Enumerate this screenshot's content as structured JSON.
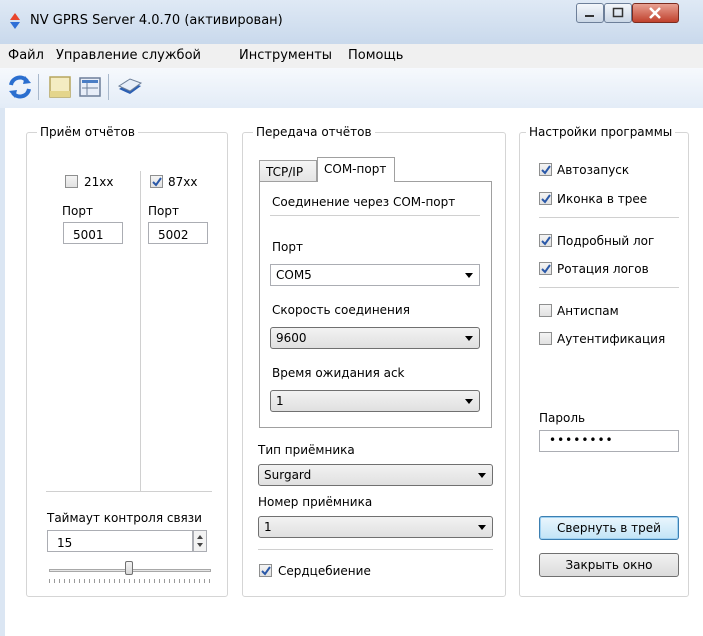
{
  "window": {
    "title": "NV GPRS Server 4.0.70  (активирован)"
  },
  "menu": [
    "Файл",
    "Управление службой",
    "Инструменты",
    "Помощь"
  ],
  "toolbar": {
    "icons": [
      "refresh-icon",
      "panel-icon",
      "grid-icon",
      "book-icon"
    ]
  },
  "reports_in": {
    "title": "Приём отчётов",
    "port_a": {
      "label": "21xx",
      "checked": false,
      "port_label": "Порт",
      "port_value": "5001"
    },
    "port_b": {
      "label": "87xx",
      "checked": true,
      "port_label": "Порт",
      "port_value": "5002"
    },
    "timeout_label": "Таймаут контроля связи",
    "timeout_value": "15"
  },
  "reports_out": {
    "title": "Передача отчётов",
    "tabs": [
      "TCP/IP",
      "COM-порт"
    ],
    "active_tab": 1,
    "com": {
      "heading": "Соединение через COM-порт",
      "port_label": "Порт",
      "port_value": "COM5",
      "speed_label": "Скорость соединения",
      "speed_value": "9600",
      "ack_label": "Время ожидания ack",
      "ack_value": "1"
    },
    "receiver_type_label": "Тип приёмника",
    "receiver_type_value": "Surgard",
    "receiver_number_label": "Номер приёмника",
    "receiver_number_value": "1",
    "heartbeat_label": "Сердцебиение",
    "heartbeat_checked": true
  },
  "settings": {
    "title": "Настройки программы",
    "autostart": {
      "label": "Автозапуск",
      "checked": true
    },
    "tray_icon": {
      "label": "Иконка в трее",
      "checked": true
    },
    "verbose_log": {
      "label": "Подробный лог",
      "checked": true
    },
    "log_rotation": {
      "label": "Ротация логов",
      "checked": true
    },
    "antispam": {
      "label": "Антиспам",
      "checked": false
    },
    "auth": {
      "label": "Аутентификация",
      "checked": false
    },
    "password_label": "Пароль",
    "password_value": "••••••••",
    "minimize_button": "Свернуть в трей",
    "close_button": "Закрыть окно"
  },
  "colors": {
    "accent": "#3c7fb1",
    "check": "#2a58a8"
  }
}
